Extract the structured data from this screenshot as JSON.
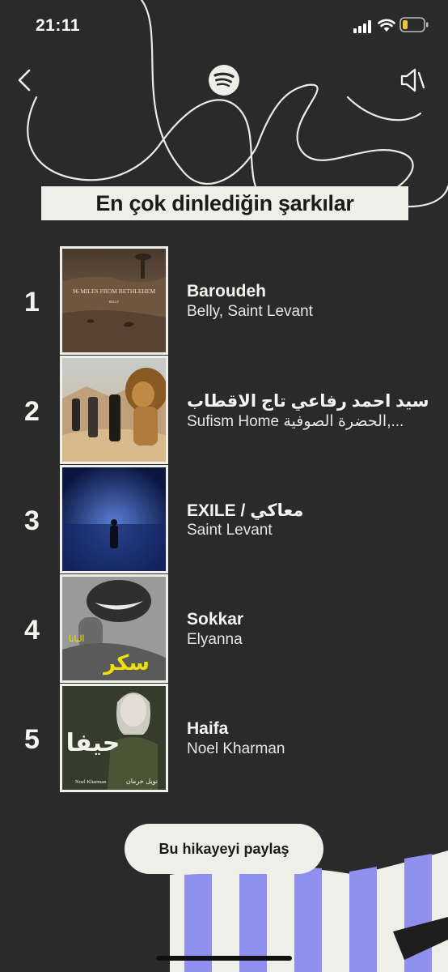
{
  "status": {
    "time": "21:11"
  },
  "header": {
    "title": "En çok dinlediğin şarkılar"
  },
  "tracks": [
    {
      "rank": "1",
      "title": "Baroudeh",
      "artist": "Belly, Saint Levant",
      "cover_text": "96 MILES FROM BETHLEHEM",
      "cover_subtext": "BELLY"
    },
    {
      "rank": "2",
      "title": "سيد احمد رفاعي تاج الاقطاب",
      "artist": "Sufism Home الحضرة الصوفية,..."
    },
    {
      "rank": "3",
      "title": "EXILE / معاكي",
      "artist": "Saint Levant"
    },
    {
      "rank": "4",
      "title": "Sokkar",
      "artist": "Elyanna",
      "cover_text": "سكر",
      "cover_subtext": "اليانا"
    },
    {
      "rank": "5",
      "title": "Haifa",
      "artist": "Noel Kharman",
      "cover_text": "حيفا",
      "cover_subtext": "Noel Kharman",
      "cover_subtext_ar": "نويل خرمان"
    }
  ],
  "actions": {
    "share_label": "Bu hikayeyi paylaş"
  },
  "icons": {
    "back": "chevron-left-icon",
    "logo": "spotify-logo-icon",
    "sound": "speaker-muted-icon"
  },
  "colors": {
    "background": "#2a2a2a",
    "accent_light": "#efefea",
    "stripe_purple": "#8f8ff0"
  }
}
